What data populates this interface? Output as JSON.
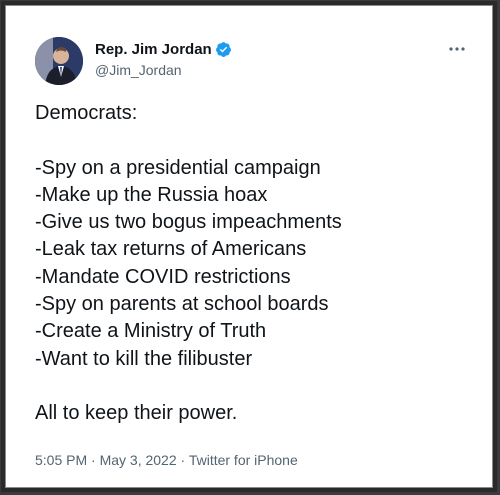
{
  "author": {
    "display_name": "Rep. Jim Jordan",
    "handle": "@Jim_Jordan"
  },
  "icons": {
    "verified": "verified-badge-icon",
    "more": "more-options-icon"
  },
  "colors": {
    "verified": "#1d9bf0",
    "text": "#0f1419",
    "secondary": "#536471"
  },
  "tweet": {
    "lines": [
      "Democrats:",
      "",
      "-Spy on a presidential campaign",
      "-Make up the Russia hoax",
      "-Give us two bogus impeachments",
      "-Leak tax returns of Americans",
      "-Mandate COVID restrictions",
      "-Spy on parents at school boards",
      "-Create a Ministry of Truth",
      "-Want to kill the filibuster",
      "",
      "All to keep their power."
    ]
  },
  "meta": {
    "text": "5:05 PM · May 3, 2022 · Twitter for iPhone"
  }
}
